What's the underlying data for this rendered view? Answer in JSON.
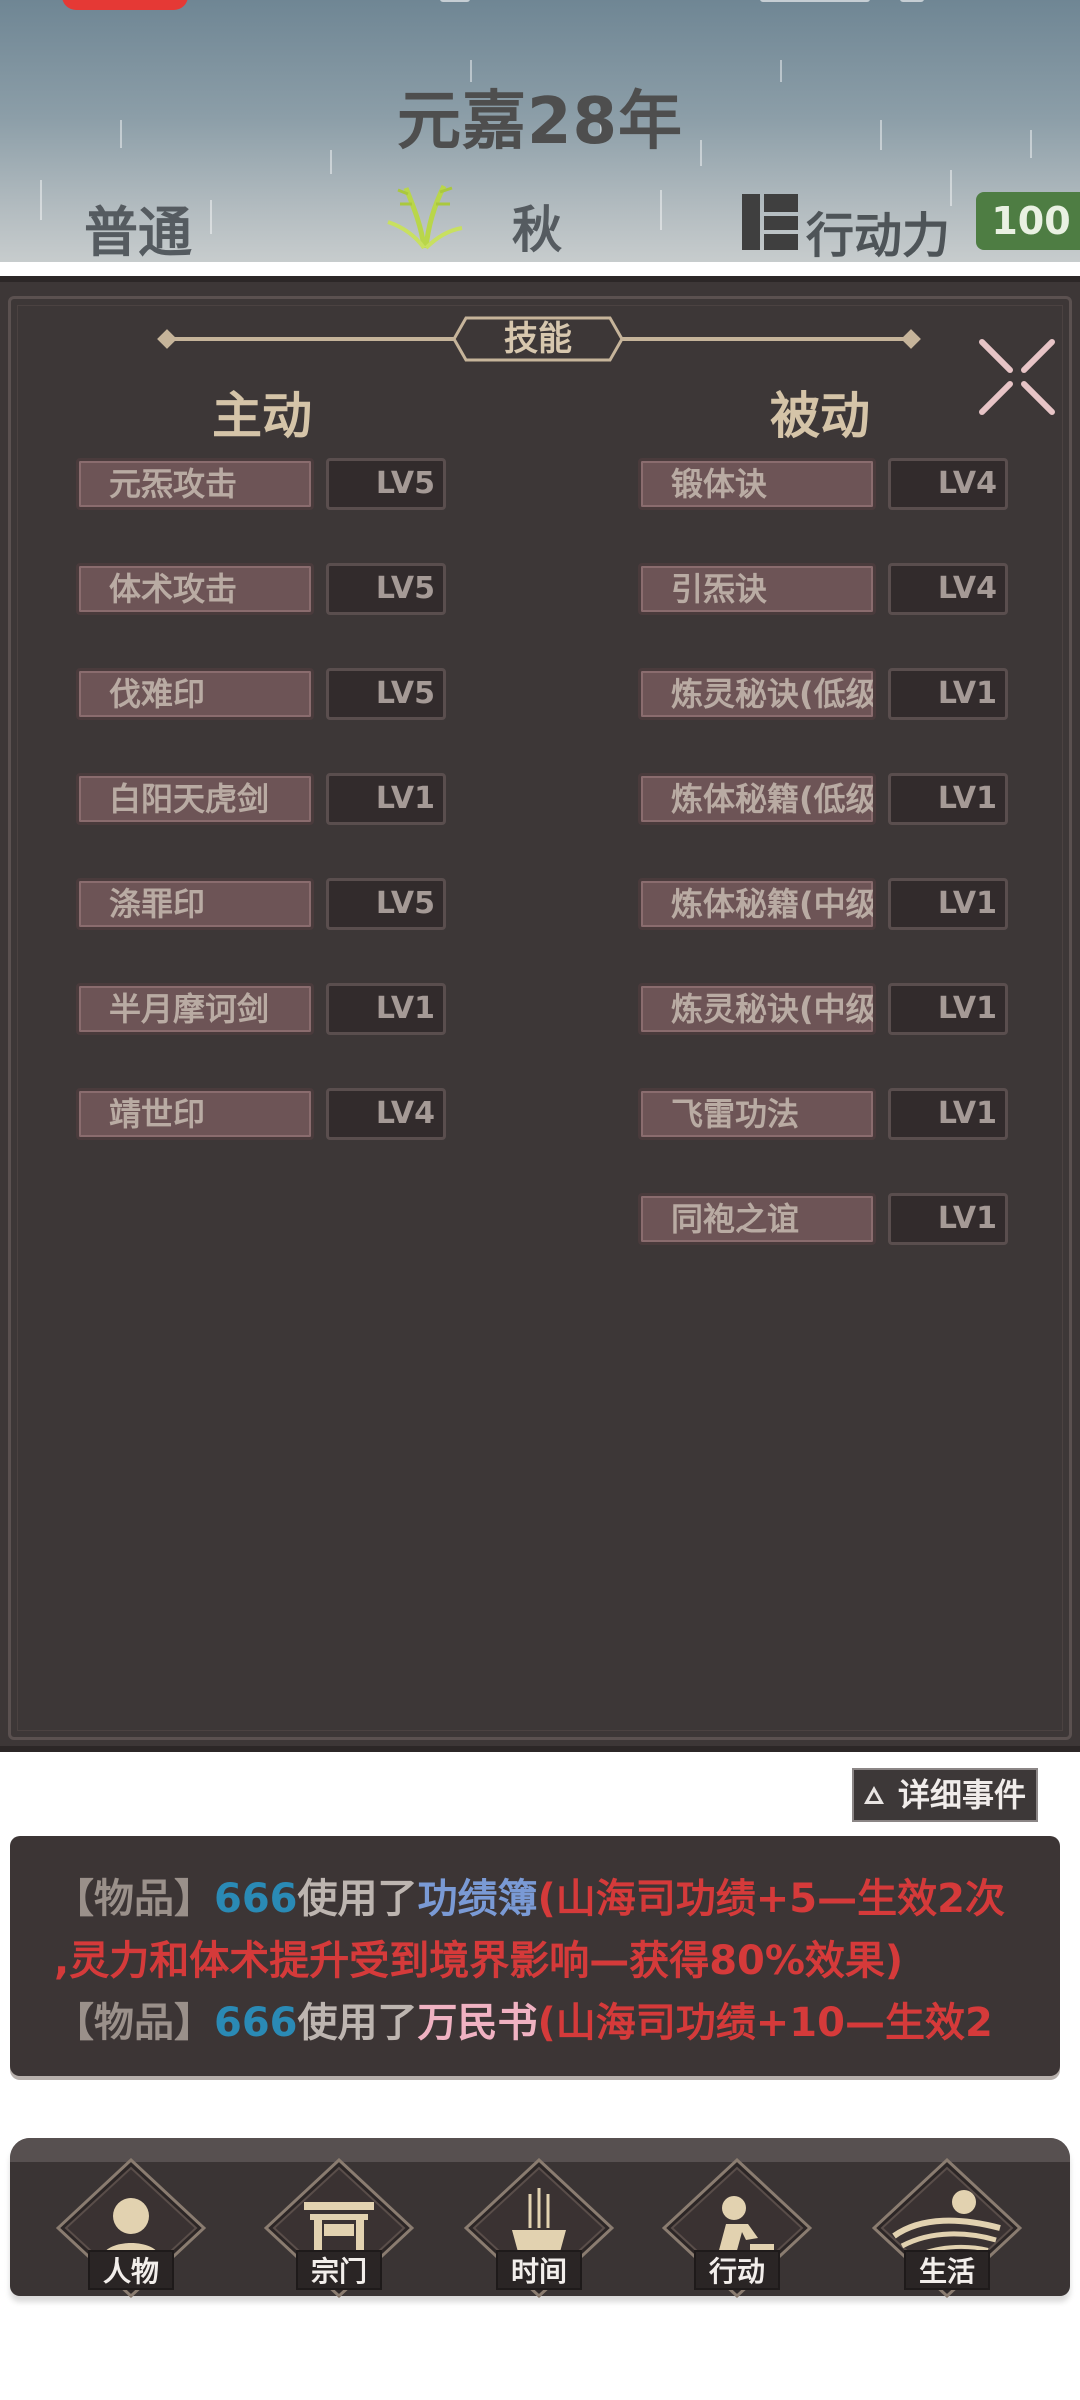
{
  "header": {
    "year": "元嘉28年",
    "difficulty": "普通",
    "season": "秋",
    "action_points_label": "行动力",
    "action_points_value": "100"
  },
  "skills_panel": {
    "title": "技能",
    "active_heading": "主动",
    "passive_heading": "被动",
    "active": [
      {
        "name": "元炁攻击",
        "level": "LV5"
      },
      {
        "name": "体术攻击",
        "level": "LV5"
      },
      {
        "name": "伐难印",
        "level": "LV5"
      },
      {
        "name": "白阳天虎剑",
        "level": "LV1"
      },
      {
        "name": "涤罪印",
        "level": "LV5"
      },
      {
        "name": "半月摩诃剑",
        "level": "LV1"
      },
      {
        "name": "靖世印",
        "level": "LV4"
      }
    ],
    "passive": [
      {
        "name": "锻体诀",
        "level": "LV4"
      },
      {
        "name": "引炁诀",
        "level": "LV4"
      },
      {
        "name": "炼灵秘诀(低级",
        "level": "LV1"
      },
      {
        "name": "炼体秘籍(低级",
        "level": "LV1"
      },
      {
        "name": "炼体秘籍(中级",
        "level": "LV1"
      },
      {
        "name": "炼灵秘诀(中级",
        "level": "LV1"
      },
      {
        "name": "飞雷功法",
        "level": "LV1"
      },
      {
        "name": "同袍之谊",
        "level": "LV1"
      }
    ]
  },
  "events": {
    "detail_button": "详细事件",
    "lines": [
      {
        "tag": "【物品】",
        "user": "666",
        "verb": "使用了",
        "item": "功绩簿",
        "effect": "(山海司功绩+5—生效2次"
      },
      {
        "continuation": ",灵力和体术提升受到境界影响—获得80%效果)"
      },
      {
        "tag": "【物品】",
        "user": "666",
        "verb": "使用了",
        "item": "万民书",
        "effect": "(山海司功绩+10—生效2"
      }
    ]
  },
  "nav": [
    {
      "label": "人物",
      "icon": "person-icon"
    },
    {
      "label": "宗门",
      "icon": "gate-icon"
    },
    {
      "label": "时间",
      "icon": "incense-icon"
    },
    {
      "label": "行动",
      "icon": "action-icon"
    },
    {
      "label": "生活",
      "icon": "landscape-icon"
    }
  ]
}
